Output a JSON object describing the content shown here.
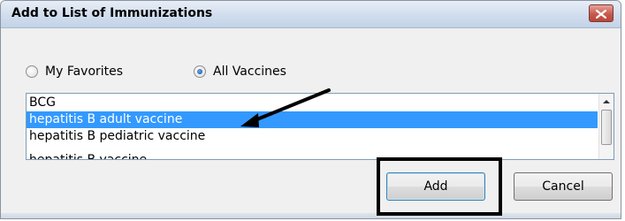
{
  "window": {
    "title": "Add to List of Immunizations"
  },
  "filters": {
    "favorites_label": "My Favorites",
    "all_label": "All Vaccines",
    "selected": "All Vaccines"
  },
  "list": {
    "items": [
      {
        "label": "BCG",
        "selected": false
      },
      {
        "label": "hepatitis B adult vaccine",
        "selected": true
      },
      {
        "label": "hepatitis B pediatric vaccine",
        "selected": false
      },
      {
        "label": "hepatitis B vaccine",
        "selected": false
      }
    ]
  },
  "buttons": {
    "add_label": "Add",
    "cancel_label": "Cancel"
  },
  "colors": {
    "selection": "#3399ff",
    "close_button": "#c7594c",
    "annotation": "#000000"
  },
  "icons": {
    "close": "close-icon",
    "scroll_up": "scroll-up-arrow-icon",
    "annotation_arrow": "annotation-arrow-icon"
  }
}
